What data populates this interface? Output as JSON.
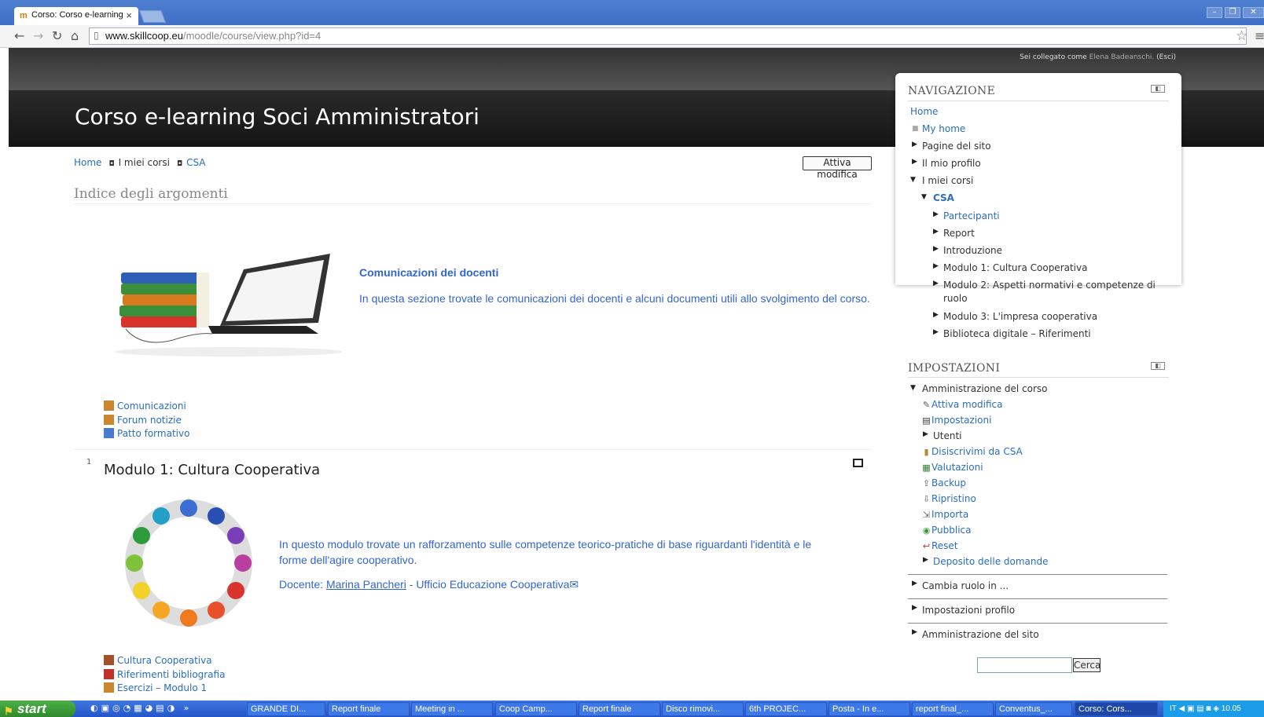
{
  "browser": {
    "tab_title": "Corso: Corso e-learning",
    "tab_close": "×",
    "url_domain": "www.skillcoop.eu",
    "url_path": "/moodle/course/view.php?id=4"
  },
  "header": {
    "login_prefix": "Sei collegato come",
    "login_user": "Elena Badeanschi.",
    "logout": "(Esci)",
    "site_title": "Corso e-learning Soci Amministratori"
  },
  "breadcrumb": {
    "home": "Home",
    "my_courses": "I miei corsi",
    "course": "CSA"
  },
  "edit_button": "Attiva modifica",
  "section0": {
    "index_title": "Indice degli argomenti",
    "title": "Comunicazioni dei docenti",
    "description": "In questa sezione trovate le comunicazioni dei docenti e alcuni documenti utili allo svolgimento del corso.",
    "activities": [
      "Comunicazioni",
      "Forum notizie",
      "Patto formativo"
    ]
  },
  "section1": {
    "number": "1",
    "title": "Modulo 1: Cultura Cooperativa",
    "description": "In questo modulo trovate un rafforzamento sulle competenze teorico-pratiche di base riguardanti l'identità e le forme dell'agire cooperativo.",
    "teacher_prefix": "Docente:",
    "teacher_name": "Marina Pancheri",
    "teacher_suffix": "- Ufficio Educazione Cooperativa",
    "activities": [
      "Cultura Cooperativa",
      "Riferimenti bibliografia",
      "Esercizi – Modulo 1"
    ]
  },
  "navigation": {
    "title": "NAVIGAZIONE",
    "home": "Home",
    "my_home": "My home",
    "site_pages": "Pagine del sito",
    "my_profile": "Il mio profilo",
    "my_courses": "I miei corsi",
    "course": "CSA",
    "course_items": [
      "Partecipanti",
      "Report",
      "Introduzione",
      "Modulo 1: Cultura Cooperativa",
      "Modulo 2: Aspetti normativi e competenze di",
      "ruolo",
      "Modulo 3: L'impresa cooperativa",
      "Biblioteca digitale – Riferimenti"
    ]
  },
  "settings": {
    "title": "IMPOSTAZIONI",
    "course_admin": "Amministrazione del corso",
    "items": [
      "Attiva modifica",
      "Impostazioni",
      "Utenti",
      "Disiscrivimi da CSA",
      "Valutazioni",
      "Backup",
      "Ripristino",
      "Importa",
      "Pubblica",
      "Reset",
      "Deposito delle domande"
    ],
    "switch_role": "Cambia ruolo in ...",
    "profile_settings": "Impostazioni profilo",
    "site_admin": "Amministrazione del sito",
    "search_button": "Cerca"
  },
  "taskbar": {
    "start": "start",
    "buttons": [
      "GRANDE DI...",
      "Report finale",
      "Meeting in ...",
      "Coop Camp...",
      "Report finale",
      "Disco rimovi...",
      "6th PROJEC...",
      "Posta - In e...",
      "report final_...",
      "Conventus_...",
      "Corso: Cors..."
    ],
    "lang": "IT",
    "clock": "10.05"
  }
}
